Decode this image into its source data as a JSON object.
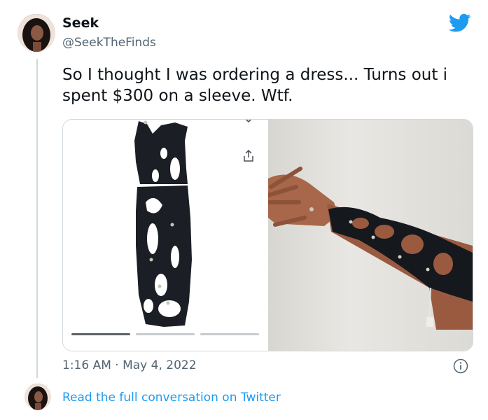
{
  "tweet": {
    "author_name": "Seek",
    "author_handle": "@SeekTheFinds",
    "text": "So I thought I was ordering a dress... Turns out i spent $300 on a sleeve. Wtf.",
    "timestamp": "1:16 AM · May 4, 2022"
  },
  "footer": {
    "read_link": "Read the full conversation on Twitter"
  },
  "media": {
    "left_image": "black cut-out sleeve garment product photo",
    "right_image": "arm wearing black cut-out sleeve",
    "carousel_dots": 3,
    "active_dot": 1
  },
  "icons": {
    "brand": "twitter-bird-icon",
    "info": "info-icon",
    "share": "share-icon",
    "chevron": "chevron-down-icon"
  },
  "colors": {
    "twitter_blue": "#1d9bf0",
    "text_primary": "#0f1419",
    "text_secondary": "#536471",
    "border": "#cfd9de"
  }
}
